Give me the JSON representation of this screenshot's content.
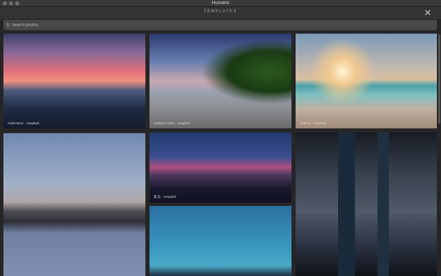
{
  "window": {
    "title": "Humans"
  },
  "header": {
    "title": "TEMPLATES",
    "close_icon": "close-icon"
  },
  "search": {
    "placeholder": "Search photos",
    "value": ""
  },
  "photos": [
    {
      "caption": "Andre Benz · Unsplash"
    },
    {
      "caption": "Andrew Coelho · Unsplash"
    },
    {
      "caption": "Sean O. · Unsplash"
    },
    {
      "caption": ""
    },
    {
      "caption": "晨 启 · Unsplash"
    },
    {
      "caption": ""
    },
    {
      "caption": ""
    }
  ]
}
